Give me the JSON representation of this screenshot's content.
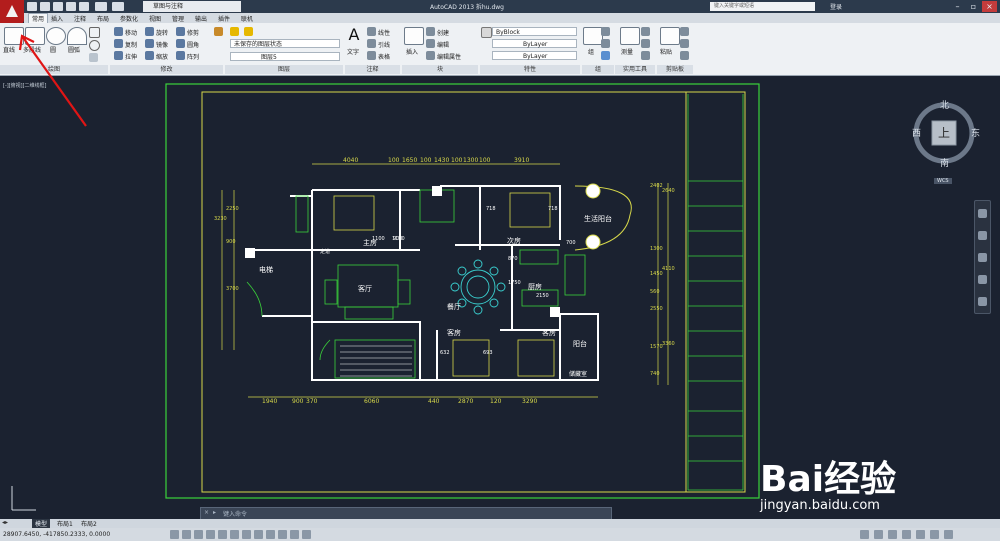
{
  "titlebar": {
    "workspace": "草图与注释",
    "title": "AutoCAD 2013    拆hu.dwg",
    "search_placeholder": "键入关键字或短语",
    "login": "登录"
  },
  "tabs": [
    "常用",
    "插入",
    "注释",
    "布局",
    "参数化",
    "视图",
    "管理",
    "输出",
    "插件",
    "联机"
  ],
  "ribbon": {
    "draw": {
      "items": [
        "直线",
        "多段线",
        "圆",
        "圆弧"
      ],
      "title": "绘图"
    },
    "modify": {
      "items": [
        "移动",
        "旋转",
        "修剪",
        "复制",
        "镜像",
        "圆角",
        "拉伸",
        "缩放",
        "阵列"
      ],
      "title": "修改"
    },
    "layer": {
      "state": "未保存的图层状态",
      "current": "图层5",
      "title": "图层"
    },
    "annotation": {
      "items": [
        "文字",
        "线性",
        "引线",
        "表格"
      ],
      "title": "注释"
    },
    "block": {
      "insert": "插入",
      "items": [
        "创建",
        "编辑",
        "编辑属性"
      ],
      "title": "块"
    },
    "properties": {
      "color": "ByBlock",
      "linetype": "ByLayer",
      "lineweight": "ByLayer",
      "title": "特性"
    },
    "group": {
      "label": "组",
      "title": "组"
    },
    "utilities": {
      "label": "测量",
      "title": "实用工具"
    },
    "clipboard": {
      "label": "粘贴",
      "title": "剪贴板"
    }
  },
  "viewport_label": "[-][俯视][二维线框]",
  "viewcube": {
    "north": "北",
    "south": "南",
    "east": "东",
    "west": "西",
    "top": "上",
    "wcs": "WCS"
  },
  "drawing": {
    "rooms": [
      "主房",
      "次房",
      "生活阳台",
      "客厅",
      "餐厅",
      "厨房",
      "客房",
      "客房",
      "阳台",
      "储藏室",
      "电梯",
      "走道"
    ],
    "top_dims": [
      "4040",
      "100",
      "1650",
      "100",
      "1430",
      "100",
      "1300",
      "100",
      "3910"
    ],
    "bottom_dims": [
      "1940",
      "900",
      "370",
      "6060",
      "440",
      "2870",
      "120",
      "3290"
    ],
    "left_dims": [
      "3230",
      "2250",
      "900",
      "3700"
    ],
    "right_dims": [
      "2402",
      "2640",
      "1300",
      "1450",
      "4110",
      "560",
      "2550",
      "1570",
      "3360",
      "740"
    ],
    "small_labels": [
      "1100",
      "1100",
      "2150",
      "1750",
      "870",
      "700",
      "718",
      "718",
      "632",
      "693",
      "900"
    ]
  },
  "command": {
    "placeholder": "键入命令"
  },
  "layout_tabs": [
    "模型",
    "布局1",
    "布局2"
  ],
  "status": {
    "coords": "28907.6450, -417850.2333, 0.0000"
  },
  "watermark": {
    "brand": "Bai经验",
    "url": "jingyan.baidu.com"
  },
  "colors": {
    "wall": "#ffffff",
    "dim": "#d7d84a",
    "green": "#3ad23a",
    "cyan": "#3ad2d2",
    "bg": "#1b2230",
    "arrow": "#e01515"
  }
}
